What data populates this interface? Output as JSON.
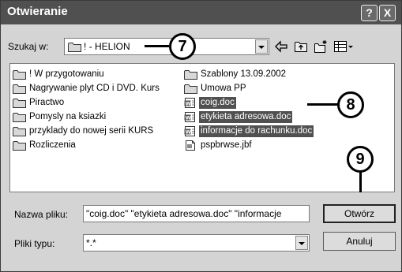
{
  "window": {
    "title": "Otwieranie",
    "help_glyph": "?",
    "close_glyph": "X"
  },
  "lookin": {
    "label": "Szukaj w:",
    "value": "! - HELION"
  },
  "toolbar": {
    "icons": [
      "back-arrow-icon",
      "up-folder-icon",
      "new-folder-icon",
      "view-menu-icon"
    ]
  },
  "files": {
    "column1": [
      {
        "name": "! W przygotowaniu",
        "type": "folder",
        "selected": false
      },
      {
        "name": "Nagrywanie plyt CD i DVD. Kurs",
        "type": "folder",
        "selected": false
      },
      {
        "name": "Piractwo",
        "type": "folder",
        "selected": false
      },
      {
        "name": "Pomysly na ksiazki",
        "type": "folder",
        "selected": false
      },
      {
        "name": "przyklady do nowej serii KURS",
        "type": "folder",
        "selected": false
      },
      {
        "name": "Rozliczenia",
        "type": "folder",
        "selected": false
      }
    ],
    "column2": [
      {
        "name": "Szablony 13.09.2002",
        "type": "folder",
        "selected": false
      },
      {
        "name": "Umowa PP",
        "type": "folder",
        "selected": false
      },
      {
        "name": "coig.doc",
        "type": "doc",
        "selected": true
      },
      {
        "name": "etykieta adresowa.doc",
        "type": "doc",
        "selected": true
      },
      {
        "name": "informacje do rachunku.doc",
        "type": "doc",
        "selected": true
      },
      {
        "name": "pspbrwse.jbf",
        "type": "jbf",
        "selected": false
      }
    ]
  },
  "filename": {
    "label": "Nazwa pliku:",
    "value": "\"coig.doc\" \"etykieta adresowa.doc\" \"informacje"
  },
  "filetype": {
    "label": "Pliki typu:",
    "value": "*.*"
  },
  "buttons": {
    "open": "Otwórz",
    "cancel": "Anuluj"
  },
  "callouts": {
    "c7": "7",
    "c8": "8",
    "c9": "9"
  },
  "colors": {
    "titlebar": "#505050",
    "selection": "#505050",
    "dialog_bg": "#d4d4d4"
  }
}
